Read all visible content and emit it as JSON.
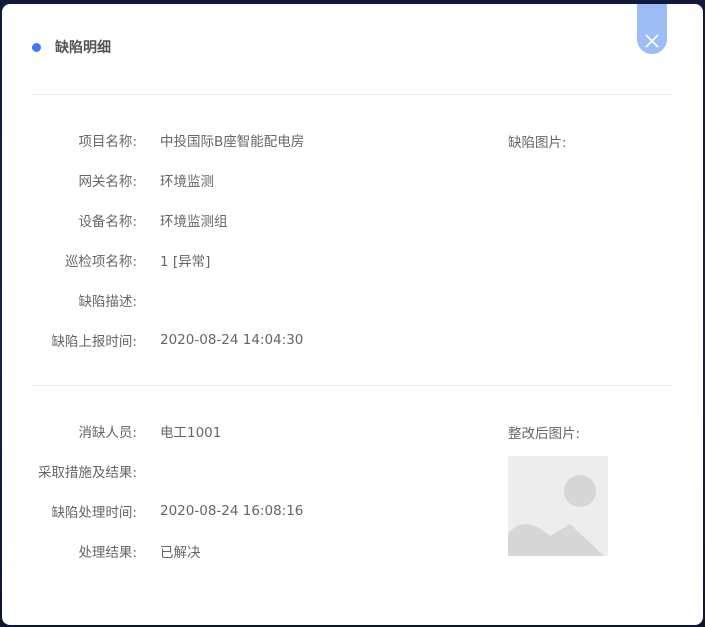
{
  "dialog": {
    "title": "缺陷明细",
    "close_icon": "close-icon",
    "accent": "#3f7be5",
    "close_bg": "#9dbcf4"
  },
  "defect": {
    "fields": [
      {
        "label": "项目名称:",
        "value": "中投国际B座智能配电房"
      },
      {
        "label": "网关名称:",
        "value": "环境监测"
      },
      {
        "label": "设备名称:",
        "value": "环境监测组"
      },
      {
        "label": "巡检项名称:",
        "value": "1 [异常]"
      },
      {
        "label": "缺陷描述:",
        "value": ""
      },
      {
        "label": "缺陷上报时间:",
        "value": "2020-08-24 14:04:30"
      }
    ],
    "image_label": "缺陷图片:"
  },
  "rectify": {
    "fields": [
      {
        "label": "消缺人员:",
        "value": "电工1001"
      },
      {
        "label": "采取措施及结果:",
        "value": ""
      },
      {
        "label": "缺陷处理时间:",
        "value": "2020-08-24 16:08:16"
      },
      {
        "label": "处理结果:",
        "value": "已解决"
      }
    ],
    "image_label": "整改后图片:",
    "image_icon": "image-placeholder-icon"
  }
}
